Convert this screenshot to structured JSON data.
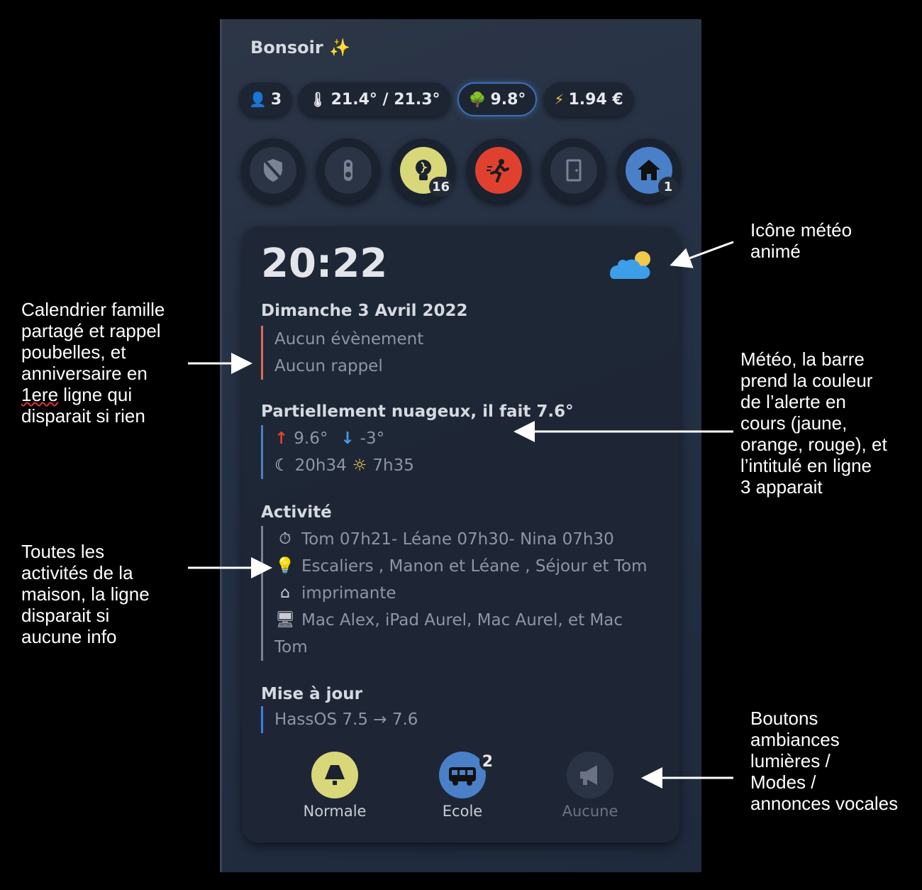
{
  "greeting": "Bonsoir ✨",
  "chips": [
    {
      "icon": "person-icon",
      "glyph": "👤",
      "value": "3"
    },
    {
      "icon": "thermometer-icon",
      "glyph": "🌡",
      "value": "21.4° / 21.3°"
    },
    {
      "icon": "tree-icon",
      "glyph": "🌳",
      "value": "9.8°"
    },
    {
      "icon": "lightning-icon",
      "glyph": "⚡",
      "value": "1.94 €"
    }
  ],
  "round_buttons": [
    {
      "icon": "shield-off-icon",
      "badge": ""
    },
    {
      "icon": "doorbell-icon",
      "badge": ""
    },
    {
      "icon": "lightbulb-icon",
      "badge": "16"
    },
    {
      "icon": "running-person-icon",
      "badge": ""
    },
    {
      "icon": "door-icon",
      "badge": ""
    },
    {
      "icon": "home-icon",
      "badge": "1"
    }
  ],
  "card": {
    "time": "20:22",
    "date": "Dimanche 3 Avril 2022",
    "calendar": [
      "Aucun évènement",
      "Aucun rappel"
    ],
    "weather_title": "Partiellement nuageux, il fait 7.6°",
    "weather_max": "9.6°",
    "weather_min": "-3°",
    "sunset": "20h34",
    "sunrise": "7h35",
    "activity_title": "Activité",
    "activity_lines": [
      "Tom 07h21- Léane 07h30- Nina 07h30",
      "Escaliers , Manon et Léane , Séjour et Tom",
      "imprimante",
      "Mac Alex, iPad Aurel, Mac Aurel, et Mac",
      "Tom"
    ],
    "update_title": "Mise à jour",
    "update_line": "HassOS 7.5 → 7.6"
  },
  "modes": [
    {
      "label": "Normale",
      "icon": "lamp-icon",
      "color": "#d8d77a",
      "badge": ""
    },
    {
      "label": "Ecole",
      "icon": "bus-icon",
      "color": "#4a80c8",
      "badge": "2"
    },
    {
      "label": "Aucune",
      "icon": "megaphone-icon",
      "color": "#2b3445",
      "badge": ""
    }
  ],
  "annotations": {
    "weather_icon": [
      "Icône météo",
      "animé"
    ],
    "calendar": [
      "Calendrier famille",
      "partagé et rappel",
      "poubelles, et",
      "anniversaire en",
      "1ere ligne qui",
      "disparait si rien"
    ],
    "meteo": [
      "Météo, la barre",
      "prend la couleur",
      "de l’alerte en",
      "cours (jaune,",
      "orange, rouge), et",
      "l’intitulé en ligne",
      "3 apparait"
    ],
    "activities": [
      "Toutes les",
      "activités de la",
      "maison, la ligne",
      "disparait si",
      "aucune info"
    ],
    "buttons": [
      "Boutons",
      "ambiances",
      "lumières /",
      "Modes /",
      "annonces vocales"
    ]
  }
}
